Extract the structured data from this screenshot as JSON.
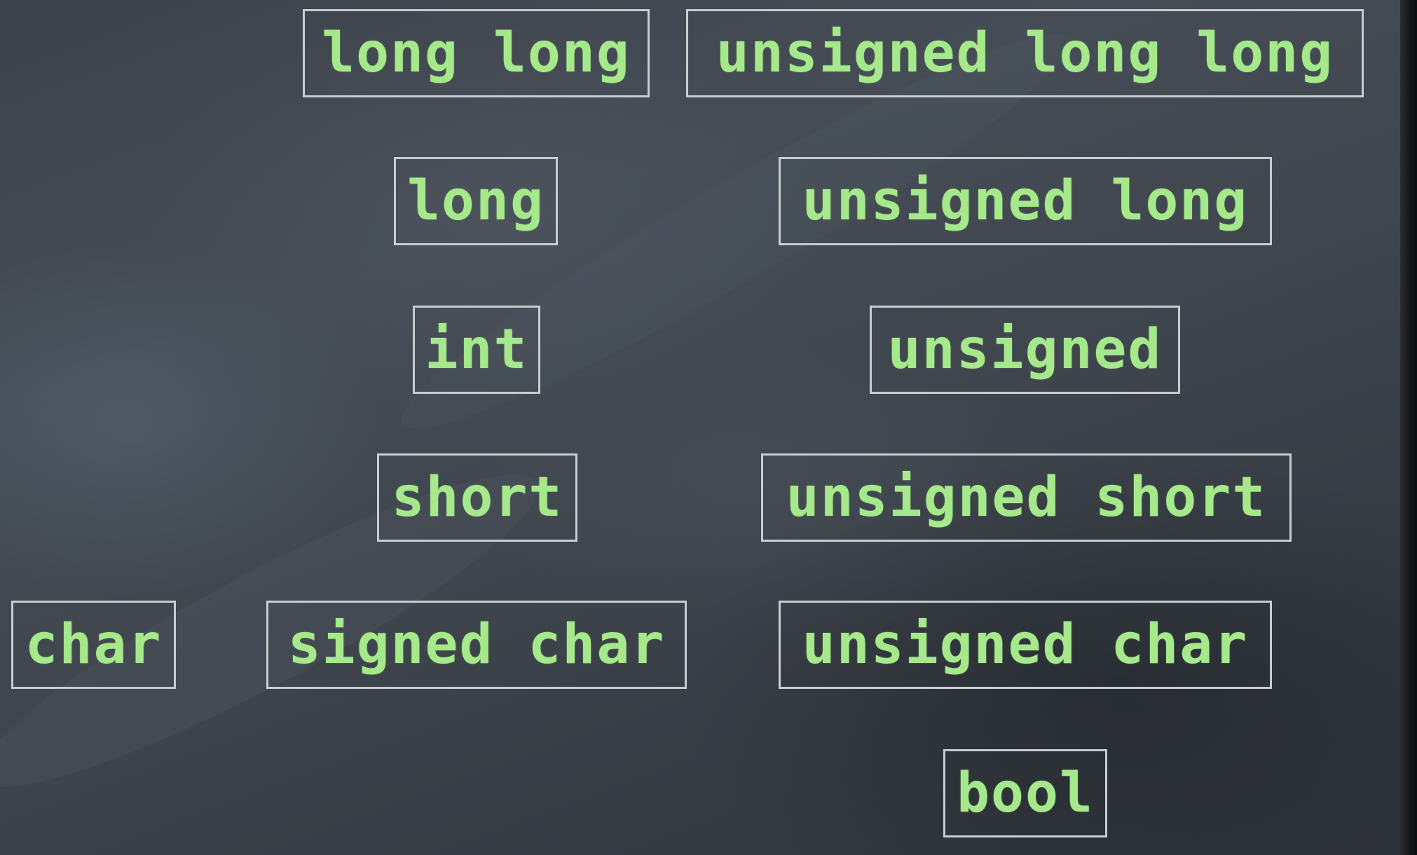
{
  "types": {
    "long_long": "long long",
    "unsigned_long_long": "unsigned long long",
    "long": "long",
    "unsigned_long": "unsigned long",
    "int": "int",
    "unsigned": "unsigned",
    "short": "short",
    "unsigned_short": "unsigned short",
    "char": "char",
    "signed_char": "signed char",
    "unsigned_char": "unsigned char",
    "bool": "bool"
  },
  "colors": {
    "text": "#a6e98a",
    "box_border": "#c9ccd0",
    "background": "#41474f"
  }
}
